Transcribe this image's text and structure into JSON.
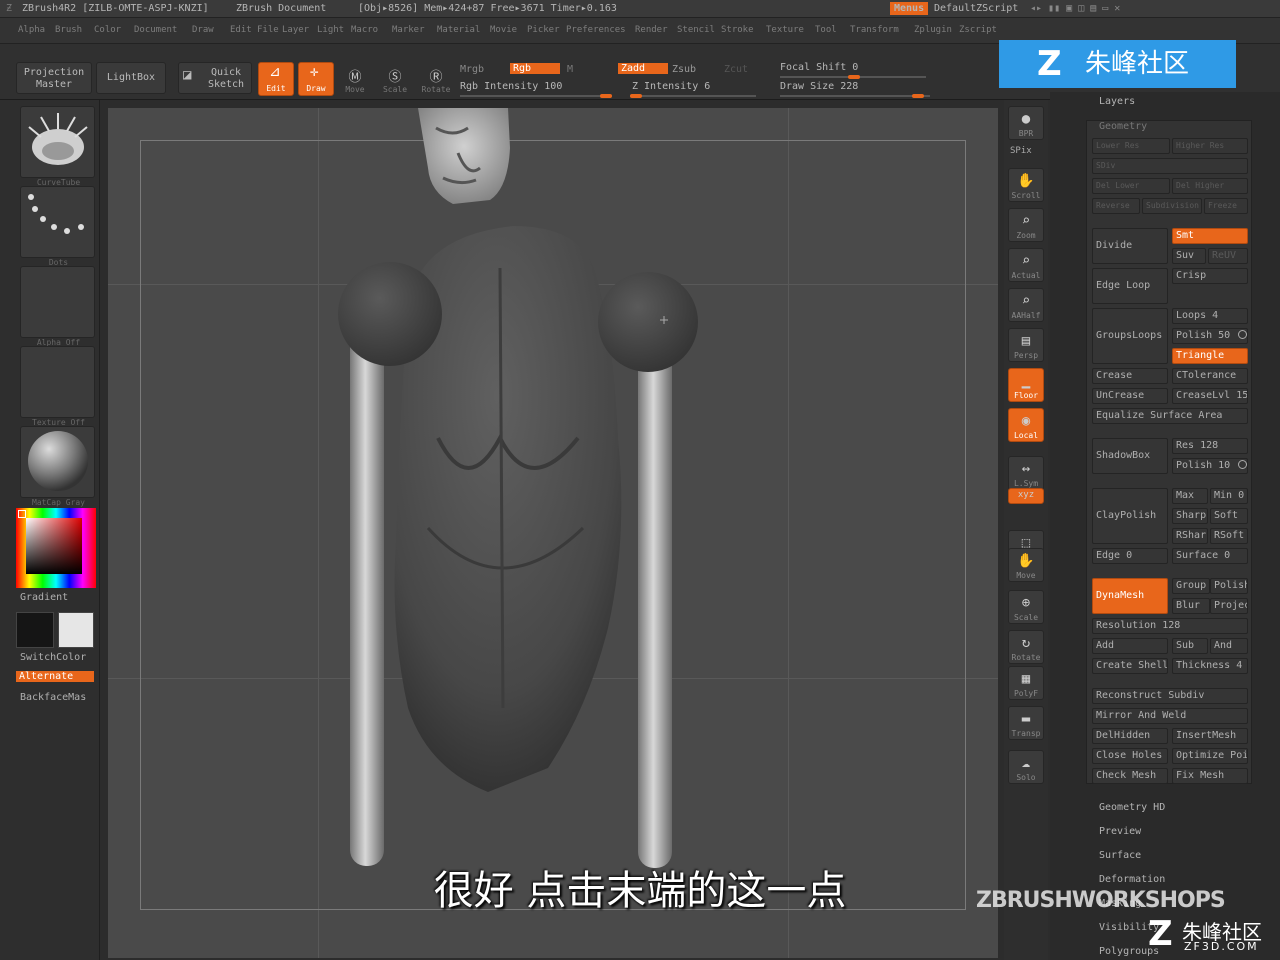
{
  "titlebar": {
    "app": "ZBrush4R2 [ZILB-OMTE-ASPJ-KNZI]",
    "doc": "ZBrush Document",
    "stats": "[Obj▸8526] Mem▸424+87 Free▸3671 Timer▸0.163",
    "menus": "Menus",
    "script": "DefaultZScript"
  },
  "menubar": [
    "Alpha",
    "Brush",
    "Color",
    "Document",
    "Draw",
    "Edit",
    "File",
    "Layer",
    "Light",
    "Macro",
    "Marker",
    "Material",
    "Movie",
    "Picker",
    "Preferences",
    "Render",
    "Stencil",
    "Stroke",
    "Texture",
    "Tool",
    "Transform",
    "Zplugin",
    "Zscript"
  ],
  "toolbar": {
    "projection_master": "Projection Master",
    "lightbox": "LightBox",
    "quick_sketch": "Quick Sketch",
    "edit": "Edit",
    "draw": "Draw",
    "move": "Move",
    "scale": "Scale",
    "rotate": "Rotate",
    "mrgb": "Mrgb",
    "rgb": "Rgb",
    "m": "M",
    "rgb_intensity": "Rgb Intensity 100",
    "zadd": "Zadd",
    "zsub": "Zsub",
    "zcut": "Zcut",
    "z_intensity": "Z Intensity 6",
    "focal_shift": "Focal Shift 0",
    "draw_size": "Draw Size 228"
  },
  "leftshelf": {
    "brush_caption": "CurveTube",
    "stroke_caption": "Dots",
    "alpha_caption": "Alpha Off",
    "texture_caption": "Texture Off",
    "material_caption": "MatCap Gray",
    "gradient": "Gradient",
    "switchcolor": "SwitchColor",
    "alternate": "Alternate",
    "backface": "BackfaceMas"
  },
  "rightshelf": [
    "BPR",
    "SPix",
    "Scroll",
    "Zoom",
    "Actual",
    "AAHalf",
    "Persp",
    "Floor",
    "Local",
    "L.Sym",
    "Xyz",
    "Frame",
    "Move",
    "Scale",
    "Rotate",
    "PolyF",
    "Transp",
    "Solo"
  ],
  "palette": {
    "layers": "Layers",
    "geometry": "Geometry",
    "dim_rows": [
      "Lower Res",
      "Higher Res",
      "SDiv",
      "Del Lower",
      "Del Higher",
      "Reverse",
      "Subdivision",
      "Freeze"
    ],
    "divide": "Divide",
    "smt": "Smt",
    "suv": "Suv",
    "reuv": "ReUV",
    "edge_loop": "Edge Loop",
    "crisp": "Crisp",
    "loops": "Loops 4",
    "groupsloops": "GroupsLoops",
    "polish": "Polish 50",
    "triangle": "Triangle",
    "crease": "Crease",
    "ctolerance": "CTolerance",
    "uncrease": "UnCrease",
    "creaselvl": "CreaseLvl 15",
    "equalize": "Equalize Surface Area",
    "shadowbox": "ShadowBox",
    "res": "Res 128",
    "polish10": "Polish 10",
    "claypolish": "ClayPolish",
    "max": "Max",
    "min": "Min 0",
    "sharp": "Sharp",
    "soft": "Soft",
    "rsharp": "RShar",
    "rsoft": "RSoft",
    "edge": "Edge 0",
    "surface0": "Surface 0",
    "dynamesh": "DynaMesh",
    "group": "Group",
    "polish2": "Polish",
    "blur": "Blur",
    "project": "Projec",
    "resolution": "Resolution 128",
    "add": "Add",
    "sub": "Sub",
    "and": "And",
    "create_shell": "Create Shell",
    "thickness": "Thickness 4",
    "reconstruct": "Reconstruct Subdiv",
    "mirror_weld": "Mirror And Weld",
    "delhidden": "DelHidden",
    "insertmesh": "InsertMesh",
    "close_holes": "Close Holes",
    "optimize": "Optimize Poi",
    "check_mesh": "Check Mesh",
    "fix_mesh": "Fix Mesh",
    "geometry_hd": "Geometry HD",
    "preview": "Preview",
    "surface": "Surface",
    "deformation": "Deformation",
    "masking": "Masking",
    "visibility": "Visibility",
    "polygroups": "Polygroups"
  },
  "overlay": {
    "logo_top": "朱峰社区",
    "logo_mark": "Z",
    "subtitle": "很好  点击末端的这一点",
    "workshops": "ZBRUSHWORKSHOPS",
    "zf3d_cn": "朱峰社区",
    "zf3d_en": "ZF3D.COM"
  },
  "colors": {
    "accent": "#e8661b",
    "canvas": "#4a4a4a",
    "ui_dark": "#2c2c2c",
    "logo_blue": "#2f9ae6"
  }
}
